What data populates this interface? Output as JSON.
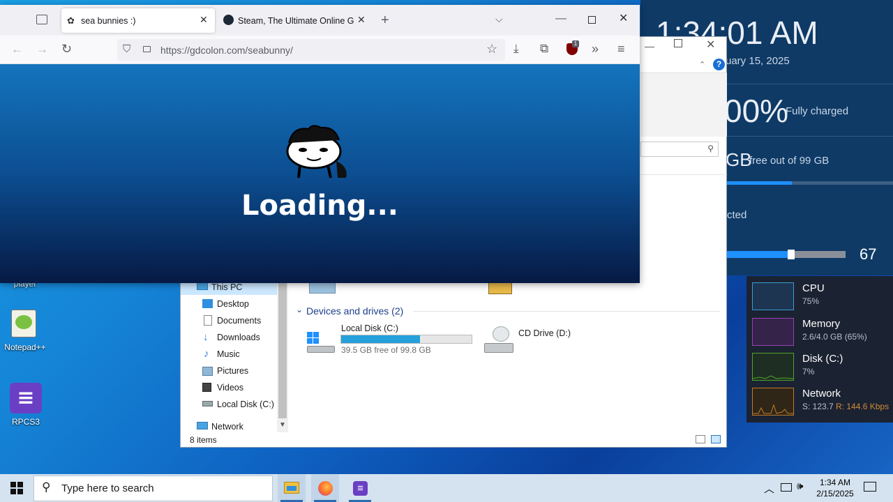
{
  "widgets": {
    "time": "1:34:01 AM",
    "date": "uary 15, 2025",
    "battery_pct": "00%",
    "battery_status": "Fully charged",
    "disk_big": "GB",
    "disk_label": "free out of 99 GB",
    "network_partial": "cted",
    "volume": "67"
  },
  "perf": {
    "items": [
      {
        "name": "CPU",
        "value": "75%",
        "color": "#3a9bd5"
      },
      {
        "name": "Memory",
        "value": "2.6/4.0 GB (65%)",
        "color": "#9b3fb5"
      },
      {
        "name": "Disk (C:)",
        "value": "7%",
        "color": "#4fa52b"
      },
      {
        "name": "Network",
        "value_s": "S: 123.7",
        "value_r": "R: 144.6 Kbps",
        "color": "#c07a2a"
      }
    ]
  },
  "explorer": {
    "nav": {
      "selected": "This PC",
      "items": [
        "Desktop",
        "Documents",
        "Downloads",
        "Music",
        "Pictures",
        "Videos",
        "Local Disk (C:)"
      ],
      "network": "Network"
    },
    "group_header": "Devices and drives (2)",
    "drives": [
      {
        "name": "Local Disk (C:)",
        "free": "39.5 GB free of 99.8 GB",
        "used_fraction": 0.604
      },
      {
        "name": "CD Drive (D:)"
      }
    ],
    "status": "8 items"
  },
  "desktop": {
    "icons": [
      {
        "label": "player"
      },
      {
        "label": "Notepad++"
      },
      {
        "label": "RPCS3"
      }
    ]
  },
  "firefox": {
    "tabs": [
      {
        "title": "sea bunnies :)"
      },
      {
        "title": "Steam, The Ultimate Online Game Platform"
      }
    ],
    "url": "https://gdcolon.com/seabunny/",
    "loading_text": "Loading...",
    "ublock_badge": "1"
  },
  "taskbar": {
    "search_placeholder": "Type here to search",
    "clock_time": "1:34 AM",
    "clock_date": "2/15/2025"
  }
}
